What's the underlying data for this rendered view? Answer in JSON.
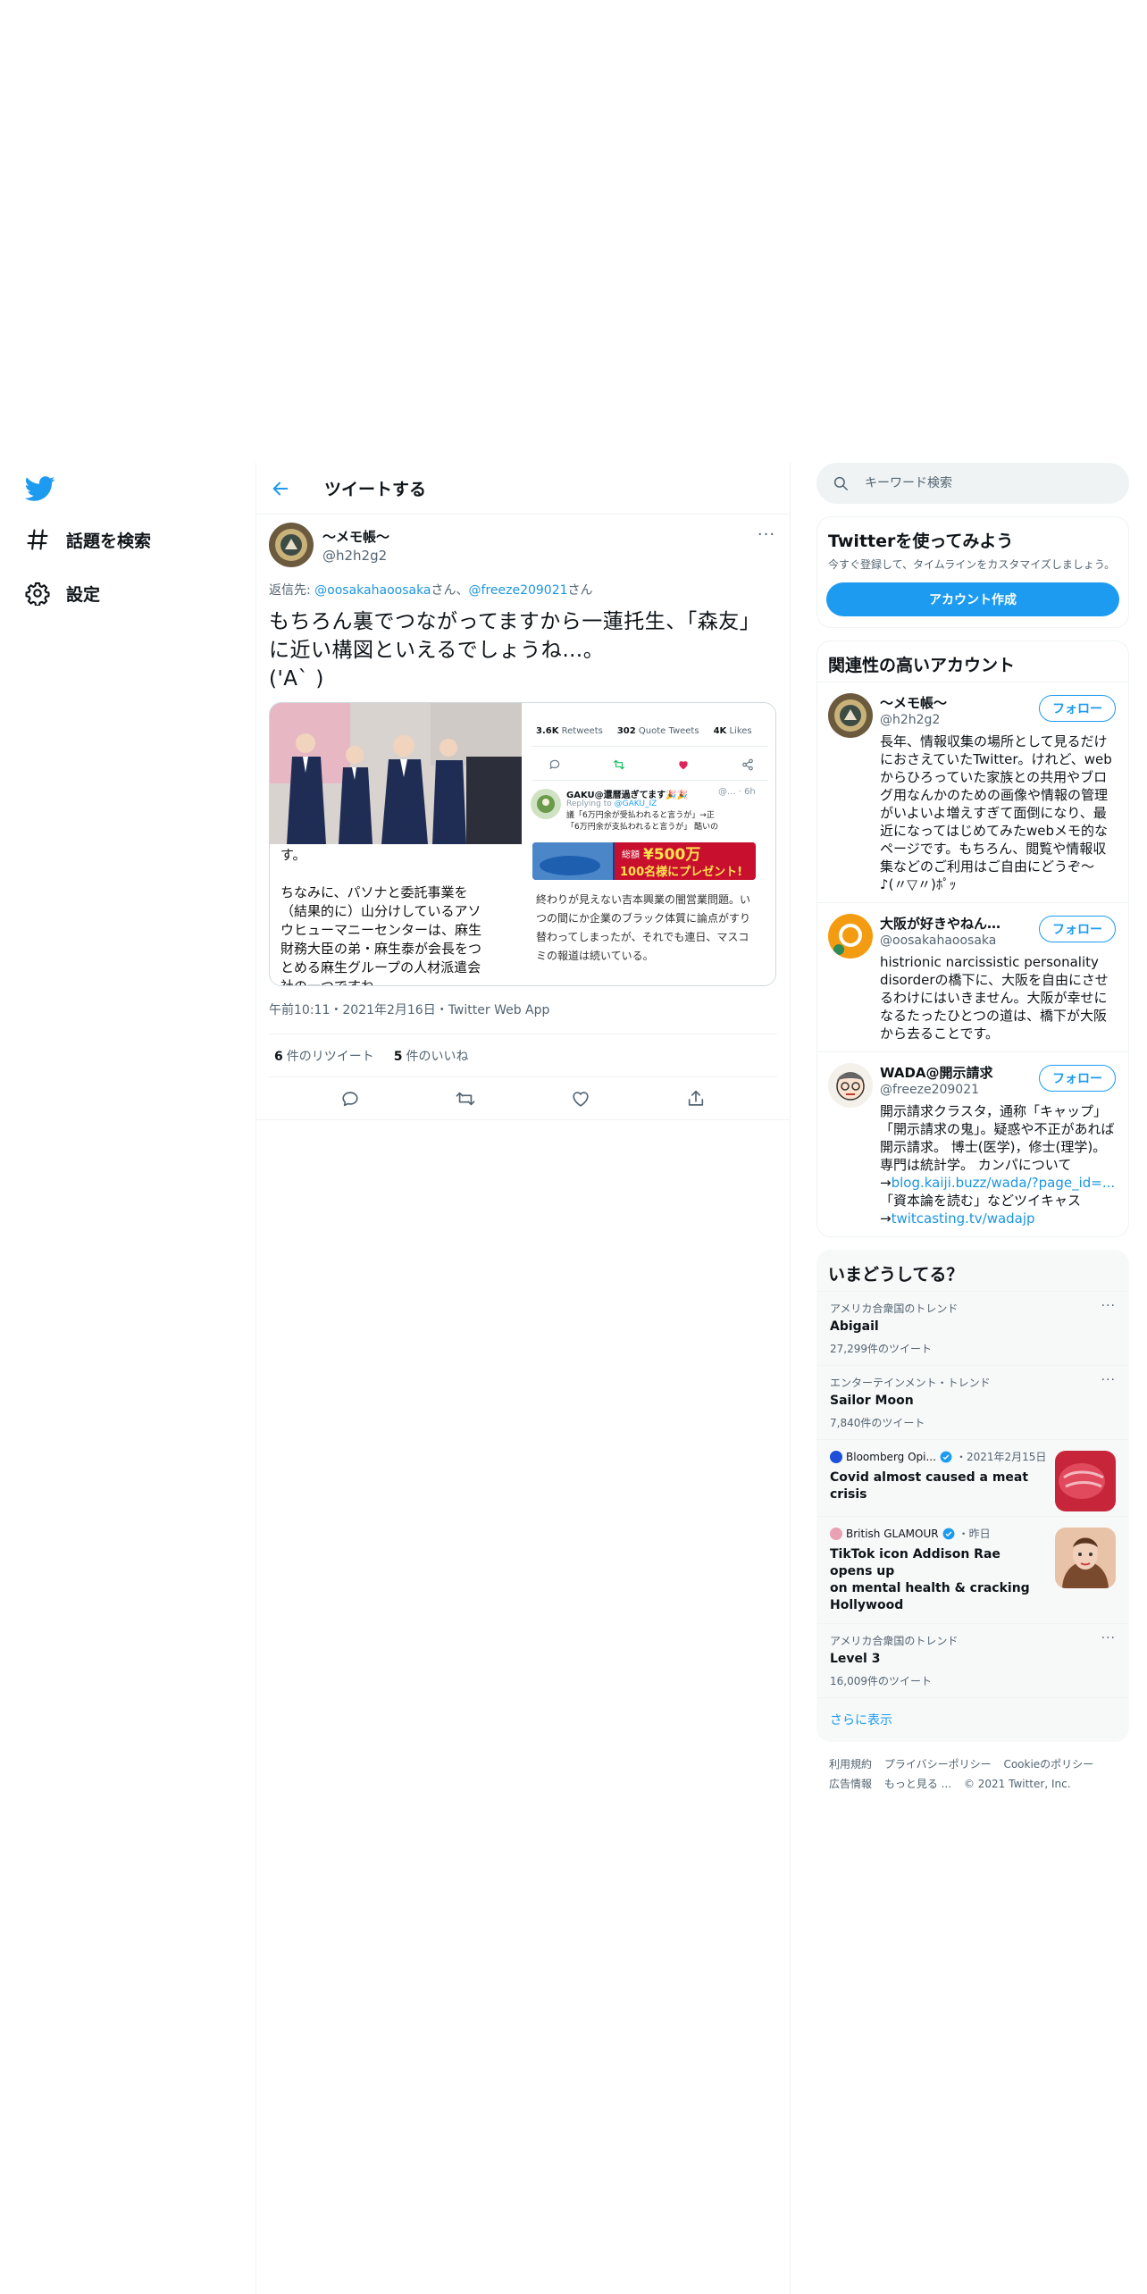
{
  "nav": {
    "explore_label": "話題を検索",
    "settings_label": "設定"
  },
  "header": {
    "title": "ツイートする"
  },
  "tweet": {
    "author_name": "～メモ帳～",
    "author_handle": "@h2h2g2",
    "reply_prefix": "返信先: ",
    "reply_user1": "@oosakahaoosaka",
    "reply_mid": "さん、",
    "reply_user2": "@freeze209021",
    "reply_suffix": "さん",
    "text": "もちろん裏でつながってますから一蓮托生、「森友」\nに近い構図といえるでしょうね…。\n('A` )",
    "media": {
      "article_text": "す。\n\nちなみに、パソナと委託事業を\n（結果的に）山分けしているアソ\nウヒューマニーセンターは、麻生\n財務大臣の弟・麻生泰が会長をつ\nとめる麻生グループの人材派遣会\n社の一つですね",
      "retweets": "3.6K",
      "retweets_label": "Retweets",
      "quotes": "302",
      "quotes_label": "Quote Tweets",
      "likes": "4K",
      "likes_label": "Likes",
      "reply_name": "GAKU@還暦過ぎてます🎉🎉",
      "reply_meta": "@... · 6h",
      "replying_prefix": "Replying to ",
      "replying_user": "@GAKU_IZ",
      "reply_body": "議「6万円余が受払われると言うが」→正\n「6万円余が支払われると言うが」 酷いの",
      "banner_text1": "総額",
      "banner_text2": "¥500万",
      "banner_text3": "100名様にプレゼント!",
      "news_text": "終わりが見えない吉本興業の闇営業問題。い\nつの間にか企業のブラック体質に論点がすり\n替わってしまったが、それでも連日、マスコ\nミの報道は続いている。"
    },
    "timestamp": "午前10:11・2021年2月16日・Twitter Web App",
    "retweet_count": "6",
    "retweet_label": "件のリツイート",
    "like_count": "5",
    "like_label": "件のいいね"
  },
  "search": {
    "placeholder": "キーワード検索"
  },
  "signup": {
    "title": "Twitterを使ってみよう",
    "description": "今すぐ登録して、タイムラインをカスタマイズしましょう。",
    "button": "アカウント作成"
  },
  "related": {
    "title": "関連性の高いアカウント",
    "follow_label": "フォロー",
    "accounts": [
      {
        "name": "～メモ帳～",
        "handle": "@h2h2g2",
        "bio": "長年、情報収集の場所として見るだけにおさえていたTwitter。けれど、webからひろっていた家族との共用やブログ用なんかのための画像や情報の管理がいよいよ増えすぎて面倒になり、最近になってはじめてみたwebメモ的なページです。もちろん、閲覧や情報収集などのご利用はご自由にどうぞ～♪(〃▽〃)ﾎﾟｯ"
      },
      {
        "name": "大阪が好きやねん@...",
        "handle": "@oosakahaoosaka",
        "bio": "histrionic narcissistic personality disorderの橋下に、大阪を自由にさせるわけにはいきません。大阪が幸せになるたったひとつの道は、橋下が大阪から去ることです。"
      },
      {
        "name": "WADA@開示請求",
        "handle": "@freeze209021",
        "bio_part1": "開示請求クラスタ，通称「キャップ」「開示請求の鬼」。疑惑や不正があれば開示請求。 博士(医学)，修士(理学)。専門は統計学。 カンパについて →",
        "bio_link1": "blog.kaiji.buzz/wada/?page_id=...",
        "bio_part2": "「資本論を読む」などツイキャス →",
        "bio_link2": "twitcasting.tv/wadajp"
      }
    ]
  },
  "trends": {
    "title": "いまどうしてる？",
    "items": [
      {
        "context": "アメリカ合衆国のトレンド",
        "name": "Abigail",
        "count": "27,299件のツイート"
      },
      {
        "context": "エンターテインメント・トレンド",
        "name": "Sailor Moon",
        "count": "7,840件のツイート"
      }
    ],
    "news": [
      {
        "source": "Bloomberg Opi...",
        "time": "・2021年2月15日",
        "title": "Covid almost caused a meat crisis"
      },
      {
        "source": "British GLAMOUR",
        "time": "・昨日",
        "title": "TikTok icon Addison Rae opens up\non mental health & cracking\nHollywood"
      }
    ],
    "last": {
      "context": "アメリカ合衆国のトレンド",
      "name": "Level 3",
      "count": "16,009件のツイート"
    },
    "show_more": "さらに表示"
  },
  "footer": {
    "terms": "利用規約",
    "privacy": "プライバシーポリシー",
    "cookie": "Cookieのポリシー",
    "ads": "広告情報",
    "more": "もっと見る ...",
    "copyright": "© 2021 Twitter, Inc."
  },
  "colors": {
    "accent": "#1d9bf0",
    "like": "#e0245e",
    "retweet": "#17bf63"
  }
}
